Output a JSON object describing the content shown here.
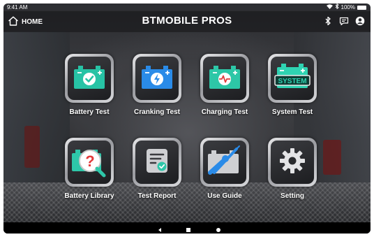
{
  "status_bar": {
    "time": "9:41 AM",
    "battery_percent": "100%"
  },
  "app_bar": {
    "home_label": "HOME",
    "title": "BTMOBILE PROS",
    "icons": [
      "bluetooth-icon",
      "message-icon",
      "account-icon"
    ]
  },
  "tiles": [
    {
      "label": "Battery Test",
      "icon": "battery-check-icon"
    },
    {
      "label": "Cranking Test",
      "icon": "battery-bolt-icon"
    },
    {
      "label": "Charging Test",
      "icon": "battery-pulse-icon"
    },
    {
      "label": "System Test",
      "icon": "battery-system-icon",
      "badge": "SYSTEM"
    },
    {
      "label": "Battery Library",
      "icon": "battery-search-icon",
      "badge": "?"
    },
    {
      "label": "Test Report",
      "icon": "report-icon"
    },
    {
      "label": "Use Guide",
      "icon": "wrench-screwdriver-icon"
    },
    {
      "label": "Setting",
      "icon": "gear-icon"
    }
  ],
  "nav_bar": {
    "buttons": [
      "back-icon",
      "home-square-icon",
      "recents-circle-icon"
    ]
  },
  "colors": {
    "battery_test": "#27c3a5",
    "cranking_test": "#2a8be8",
    "charging_test": "#2dc7a7",
    "system_test": "#2fd3b2",
    "library_magnifier": "#2ec7a9",
    "question_mark": "#e23b3b"
  }
}
